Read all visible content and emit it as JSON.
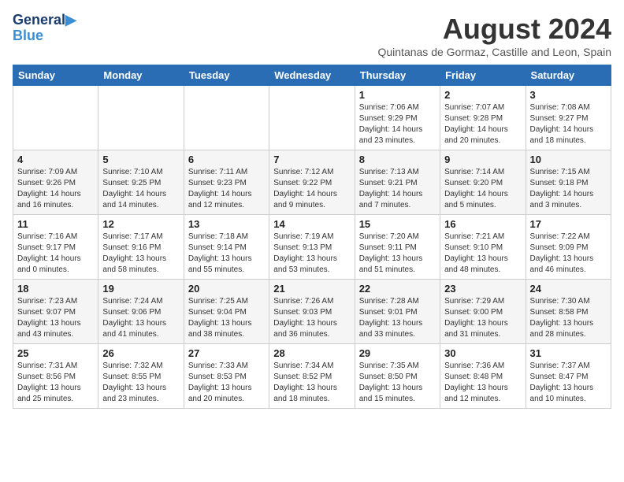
{
  "header": {
    "logo_line1": "General",
    "logo_line2": "Blue",
    "month_year": "August 2024",
    "location": "Quintanas de Gormaz, Castille and Leon, Spain"
  },
  "weekdays": [
    "Sunday",
    "Monday",
    "Tuesday",
    "Wednesday",
    "Thursday",
    "Friday",
    "Saturday"
  ],
  "weeks": [
    [
      {
        "day": "",
        "info": ""
      },
      {
        "day": "",
        "info": ""
      },
      {
        "day": "",
        "info": ""
      },
      {
        "day": "",
        "info": ""
      },
      {
        "day": "1",
        "info": "Sunrise: 7:06 AM\nSunset: 9:29 PM\nDaylight: 14 hours\nand 23 minutes."
      },
      {
        "day": "2",
        "info": "Sunrise: 7:07 AM\nSunset: 9:28 PM\nDaylight: 14 hours\nand 20 minutes."
      },
      {
        "day": "3",
        "info": "Sunrise: 7:08 AM\nSunset: 9:27 PM\nDaylight: 14 hours\nand 18 minutes."
      }
    ],
    [
      {
        "day": "4",
        "info": "Sunrise: 7:09 AM\nSunset: 9:26 PM\nDaylight: 14 hours\nand 16 minutes."
      },
      {
        "day": "5",
        "info": "Sunrise: 7:10 AM\nSunset: 9:25 PM\nDaylight: 14 hours\nand 14 minutes."
      },
      {
        "day": "6",
        "info": "Sunrise: 7:11 AM\nSunset: 9:23 PM\nDaylight: 14 hours\nand 12 minutes."
      },
      {
        "day": "7",
        "info": "Sunrise: 7:12 AM\nSunset: 9:22 PM\nDaylight: 14 hours\nand 9 minutes."
      },
      {
        "day": "8",
        "info": "Sunrise: 7:13 AM\nSunset: 9:21 PM\nDaylight: 14 hours\nand 7 minutes."
      },
      {
        "day": "9",
        "info": "Sunrise: 7:14 AM\nSunset: 9:20 PM\nDaylight: 14 hours\nand 5 minutes."
      },
      {
        "day": "10",
        "info": "Sunrise: 7:15 AM\nSunset: 9:18 PM\nDaylight: 14 hours\nand 3 minutes."
      }
    ],
    [
      {
        "day": "11",
        "info": "Sunrise: 7:16 AM\nSunset: 9:17 PM\nDaylight: 14 hours\nand 0 minutes."
      },
      {
        "day": "12",
        "info": "Sunrise: 7:17 AM\nSunset: 9:16 PM\nDaylight: 13 hours\nand 58 minutes."
      },
      {
        "day": "13",
        "info": "Sunrise: 7:18 AM\nSunset: 9:14 PM\nDaylight: 13 hours\nand 55 minutes."
      },
      {
        "day": "14",
        "info": "Sunrise: 7:19 AM\nSunset: 9:13 PM\nDaylight: 13 hours\nand 53 minutes."
      },
      {
        "day": "15",
        "info": "Sunrise: 7:20 AM\nSunset: 9:11 PM\nDaylight: 13 hours\nand 51 minutes."
      },
      {
        "day": "16",
        "info": "Sunrise: 7:21 AM\nSunset: 9:10 PM\nDaylight: 13 hours\nand 48 minutes."
      },
      {
        "day": "17",
        "info": "Sunrise: 7:22 AM\nSunset: 9:09 PM\nDaylight: 13 hours\nand 46 minutes."
      }
    ],
    [
      {
        "day": "18",
        "info": "Sunrise: 7:23 AM\nSunset: 9:07 PM\nDaylight: 13 hours\nand 43 minutes."
      },
      {
        "day": "19",
        "info": "Sunrise: 7:24 AM\nSunset: 9:06 PM\nDaylight: 13 hours\nand 41 minutes."
      },
      {
        "day": "20",
        "info": "Sunrise: 7:25 AM\nSunset: 9:04 PM\nDaylight: 13 hours\nand 38 minutes."
      },
      {
        "day": "21",
        "info": "Sunrise: 7:26 AM\nSunset: 9:03 PM\nDaylight: 13 hours\nand 36 minutes."
      },
      {
        "day": "22",
        "info": "Sunrise: 7:28 AM\nSunset: 9:01 PM\nDaylight: 13 hours\nand 33 minutes."
      },
      {
        "day": "23",
        "info": "Sunrise: 7:29 AM\nSunset: 9:00 PM\nDaylight: 13 hours\nand 31 minutes."
      },
      {
        "day": "24",
        "info": "Sunrise: 7:30 AM\nSunset: 8:58 PM\nDaylight: 13 hours\nand 28 minutes."
      }
    ],
    [
      {
        "day": "25",
        "info": "Sunrise: 7:31 AM\nSunset: 8:56 PM\nDaylight: 13 hours\nand 25 minutes."
      },
      {
        "day": "26",
        "info": "Sunrise: 7:32 AM\nSunset: 8:55 PM\nDaylight: 13 hours\nand 23 minutes."
      },
      {
        "day": "27",
        "info": "Sunrise: 7:33 AM\nSunset: 8:53 PM\nDaylight: 13 hours\nand 20 minutes."
      },
      {
        "day": "28",
        "info": "Sunrise: 7:34 AM\nSunset: 8:52 PM\nDaylight: 13 hours\nand 18 minutes."
      },
      {
        "day": "29",
        "info": "Sunrise: 7:35 AM\nSunset: 8:50 PM\nDaylight: 13 hours\nand 15 minutes."
      },
      {
        "day": "30",
        "info": "Sunrise: 7:36 AM\nSunset: 8:48 PM\nDaylight: 13 hours\nand 12 minutes."
      },
      {
        "day": "31",
        "info": "Sunrise: 7:37 AM\nSunset: 8:47 PM\nDaylight: 13 hours\nand 10 minutes."
      }
    ]
  ]
}
